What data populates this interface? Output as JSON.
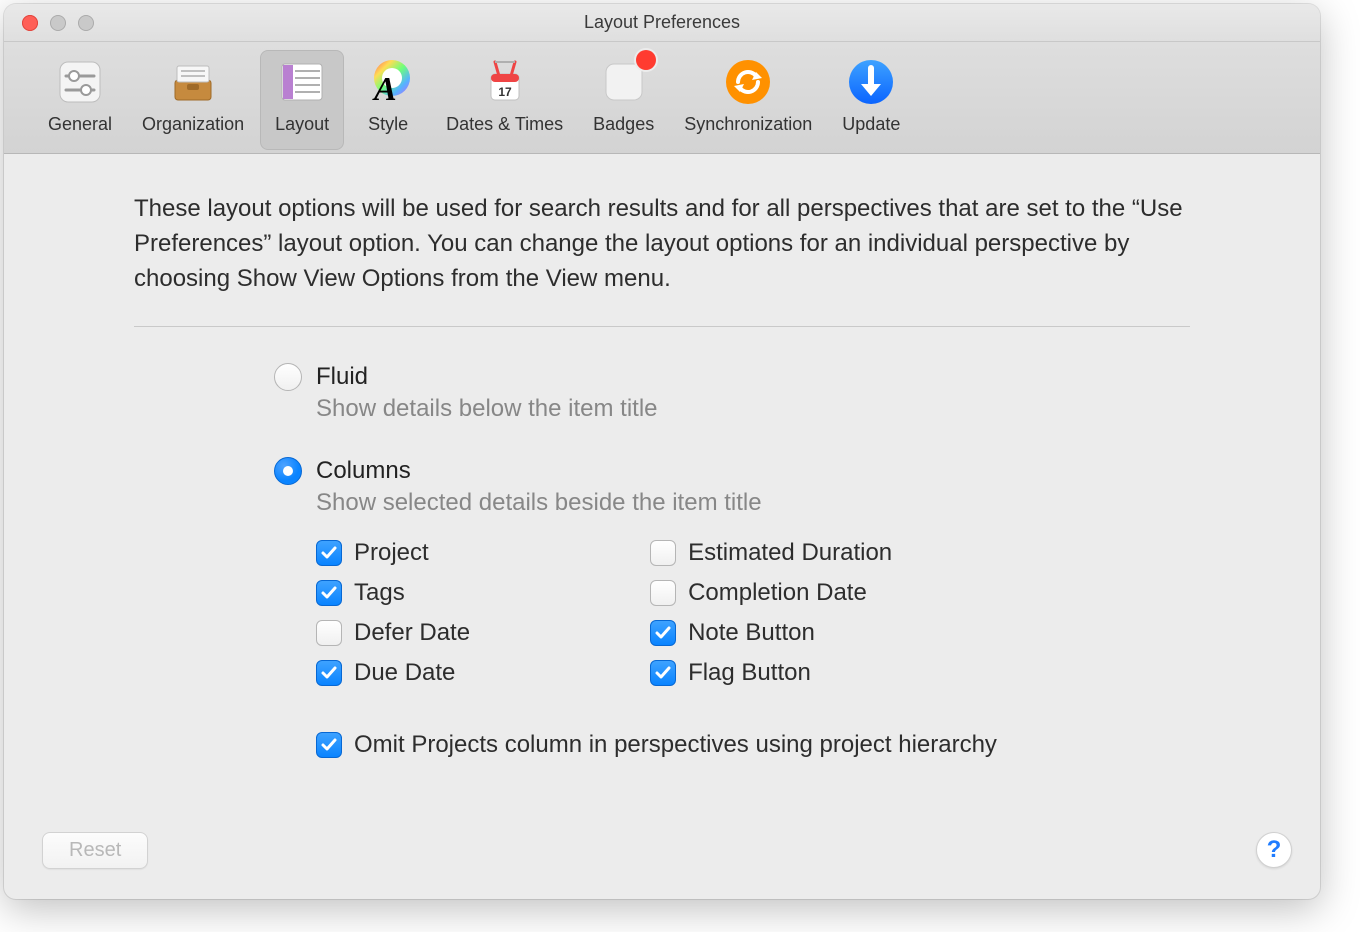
{
  "window": {
    "title": "Layout Preferences"
  },
  "toolbar": {
    "tabs": [
      {
        "id": "general",
        "label": "General",
        "selected": false
      },
      {
        "id": "organization",
        "label": "Organization",
        "selected": false
      },
      {
        "id": "layout",
        "label": "Layout",
        "selected": true
      },
      {
        "id": "style",
        "label": "Style",
        "selected": false
      },
      {
        "id": "dates",
        "label": "Dates & Times",
        "selected": false
      },
      {
        "id": "badges",
        "label": "Badges",
        "selected": false,
        "badge": true
      },
      {
        "id": "sync",
        "label": "Synchronization",
        "selected": false
      },
      {
        "id": "update",
        "label": "Update",
        "selected": false
      }
    ]
  },
  "intro": "These layout options will be used for search results and for all perspectives that are set to the “Use Preferences” layout option. You can change the layout options for an individual perspective by choosing Show View Options from the View menu.",
  "layoutMode": {
    "fluid": {
      "label": "Fluid",
      "desc": "Show details below the item title",
      "checked": false
    },
    "columns": {
      "label": "Columns",
      "desc": "Show selected details beside the item title",
      "checked": true
    }
  },
  "columnsLeft": [
    {
      "label": "Project",
      "checked": true
    },
    {
      "label": "Tags",
      "checked": true
    },
    {
      "label": "Defer Date",
      "checked": false
    },
    {
      "label": "Due Date",
      "checked": true
    }
  ],
  "columnsRight": [
    {
      "label": "Estimated Duration",
      "checked": false
    },
    {
      "label": "Completion Date",
      "checked": false
    },
    {
      "label": "Note Button",
      "checked": true
    },
    {
      "label": "Flag Button",
      "checked": true
    }
  ],
  "omit": {
    "label": "Omit Projects column in perspectives using project hierarchy",
    "checked": true
  },
  "footer": {
    "reset": "Reset",
    "help": "?"
  }
}
